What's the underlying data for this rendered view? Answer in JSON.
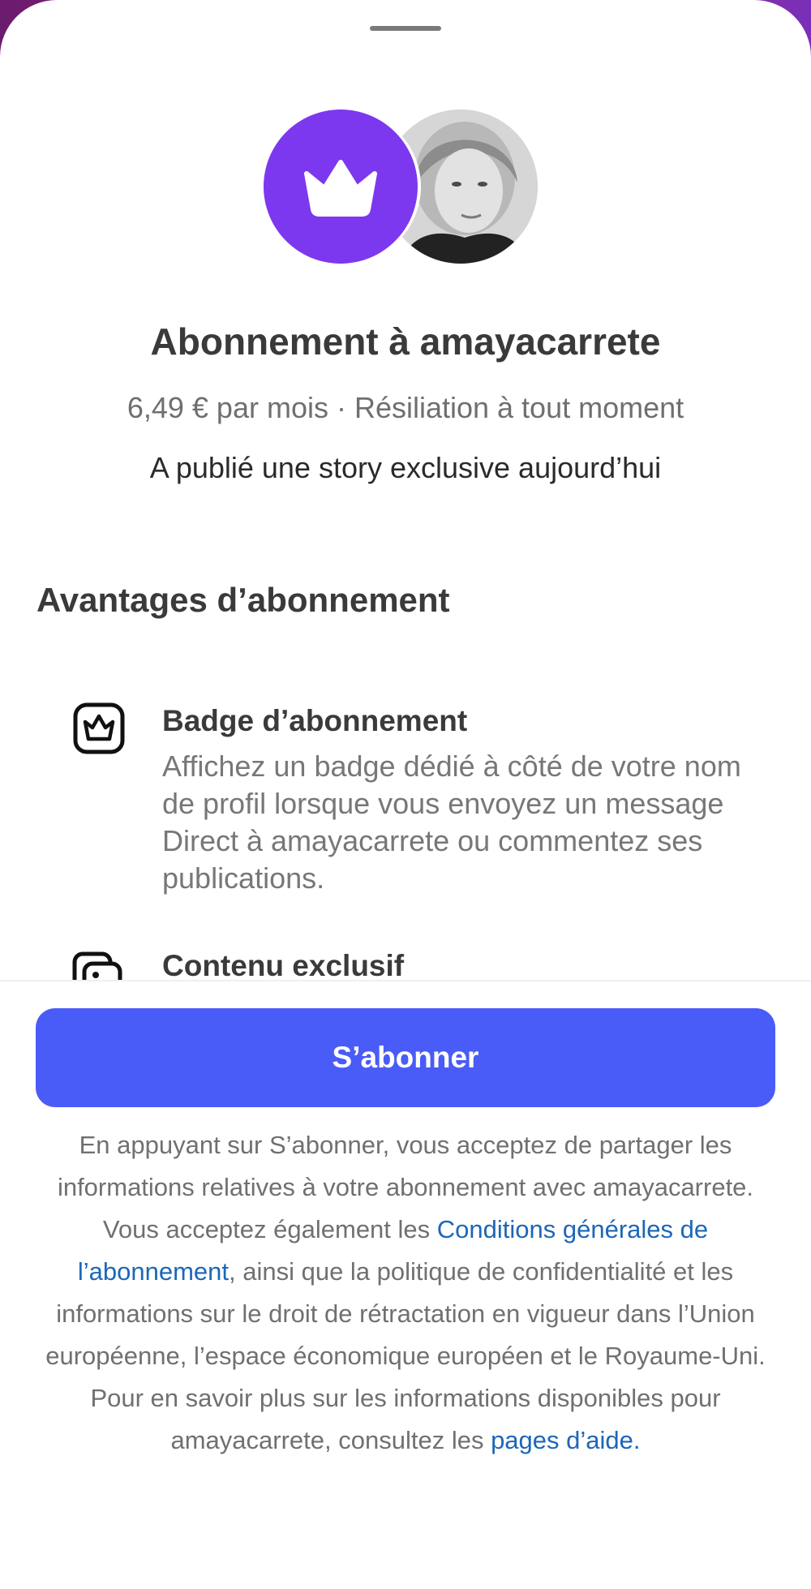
{
  "sheet": {
    "title": "Abonnement à amayacarrete",
    "price_line": "6,49 € par mois · Résiliation à tout moment",
    "story_note": "A publié une story exclusive aujourd’hui"
  },
  "avatars": {
    "crown_bg_color": "#7c38ee",
    "crown_icon": "crown-icon",
    "photo_icon": "profile-photo"
  },
  "benefits": {
    "section_title": "Avantages d’abonnement",
    "items": [
      {
        "icon": "badge-crown-icon",
        "title": "Badge d’abonnement",
        "description": "Affichez un badge dédié à côté de votre nom de profil lorsque vous envoyez un message Direct à amayacarrete ou commentez ses publications."
      },
      {
        "icon": "gallery-icon",
        "title": "Contenu exclusif",
        "description": ""
      }
    ]
  },
  "cta": {
    "subscribe_label": "S’abonner",
    "button_color": "#4a5cf7"
  },
  "legal": {
    "part1": "En appuyant sur S’abonner, vous acceptez de partager les informations relatives à votre abonnement avec amayacarrete. Vous acceptez également les ",
    "terms_link": "Conditions générales de l’abonnement",
    "part2": ", ainsi que la politique de confidentialité et les informations sur le droit de rétractation en vigueur dans l’Union européenne, l’espace économique européen et le Royaume-Uni. Pour en savoir plus sur les informations disponibles pour amayacarrete, consultez les ",
    "help_link": "pages d’aide",
    "part3": ".",
    "link_color": "#1c67b8"
  }
}
